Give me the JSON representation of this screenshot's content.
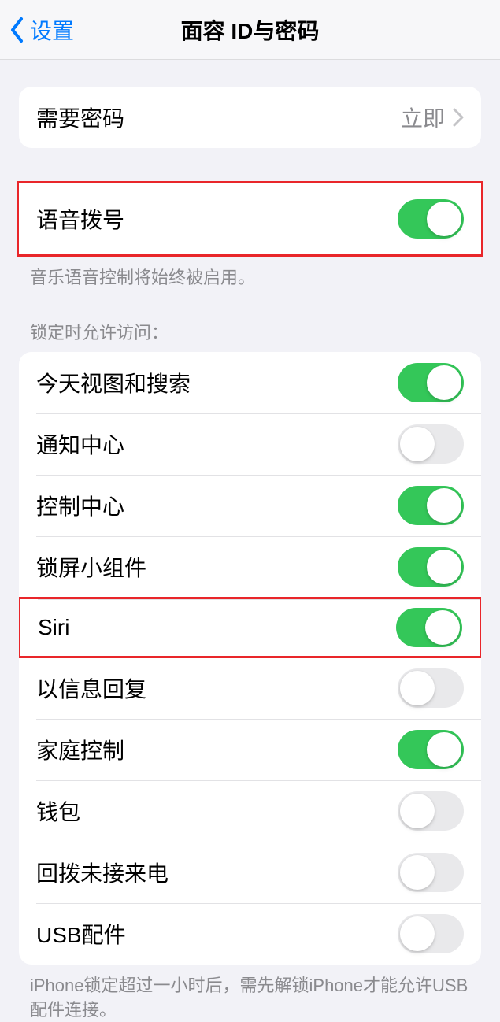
{
  "header": {
    "back_label": "设置",
    "title": "面容 ID与密码"
  },
  "passcode_row": {
    "label": "需要密码",
    "value": "立即"
  },
  "voice_dial": {
    "label": "语音拨号",
    "on": true,
    "footer": "音乐语音控制将始终被启用。"
  },
  "lock_access": {
    "header": "锁定时允许访问：",
    "items": [
      {
        "label": "今天视图和搜索",
        "on": true
      },
      {
        "label": "通知中心",
        "on": false
      },
      {
        "label": "控制中心",
        "on": true
      },
      {
        "label": "锁屏小组件",
        "on": true
      },
      {
        "label": "Siri",
        "on": true
      },
      {
        "label": "以信息回复",
        "on": false
      },
      {
        "label": "家庭控制",
        "on": true
      },
      {
        "label": "钱包",
        "on": false
      },
      {
        "label": "回拨未接来电",
        "on": false
      },
      {
        "label": "USB配件",
        "on": false
      }
    ],
    "footer": "iPhone锁定超过一小时后，需先解锁iPhone才能允许USB配件连接。"
  }
}
